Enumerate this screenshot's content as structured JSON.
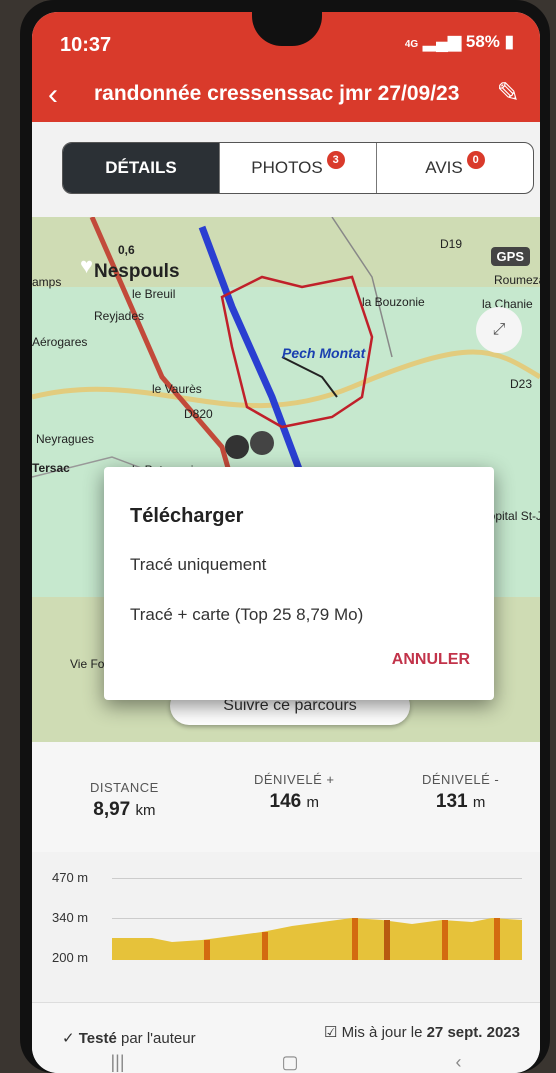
{
  "status_bar": {
    "time": "10:37",
    "signal": "4G",
    "battery": "58%"
  },
  "header": {
    "title": "randonnée cressenssac jmr 27/09/23"
  },
  "tabs": [
    {
      "label": "DÉTAILS",
      "badge": ""
    },
    {
      "label": "PHOTOS",
      "badge": "3"
    },
    {
      "label": "AVIS",
      "badge": "0"
    }
  ],
  "map": {
    "gps_label": "GPS",
    "labels": [
      "0,6",
      "Nespouls",
      "le Breuil",
      "Reyjades",
      "Aérogares",
      "la Bouzonie",
      "Pech Montat",
      "le Vaurès",
      "D820",
      "Neyragues",
      "la Paternerie",
      "Tersac",
      "D19",
      "D23",
      "amps",
      "la Chanie",
      "Roumezat",
      "Hôpital St-Jean",
      "Vie Fou"
    ],
    "follow_button": "Suivre ce parcours"
  },
  "dialog": {
    "title": "Télécharger",
    "option1": "Tracé uniquement",
    "option2": "Tracé + carte (Top 25 8,79 Mo)",
    "cancel": "ANNULER"
  },
  "stats": [
    {
      "label": "DISTANCE",
      "value": "8,97",
      "unit": "km"
    },
    {
      "label": "DÉNIVELÉ +",
      "value": "146",
      "unit": "m"
    },
    {
      "label": "DÉNIVELÉ -",
      "value": "131",
      "unit": "m"
    }
  ],
  "elevation": {
    "ticks": [
      "470 m",
      "340 m",
      "200 m"
    ]
  },
  "footer": {
    "tested_strong": "Testé",
    "tested_rest": "par l'auteur",
    "updated_prefix": "Mis à jour le",
    "updated_date": "27 sept. 2023"
  },
  "colors": {
    "brand": "#d93a2b",
    "active_tab": "#2b3035",
    "cancel": "#c2334a"
  }
}
